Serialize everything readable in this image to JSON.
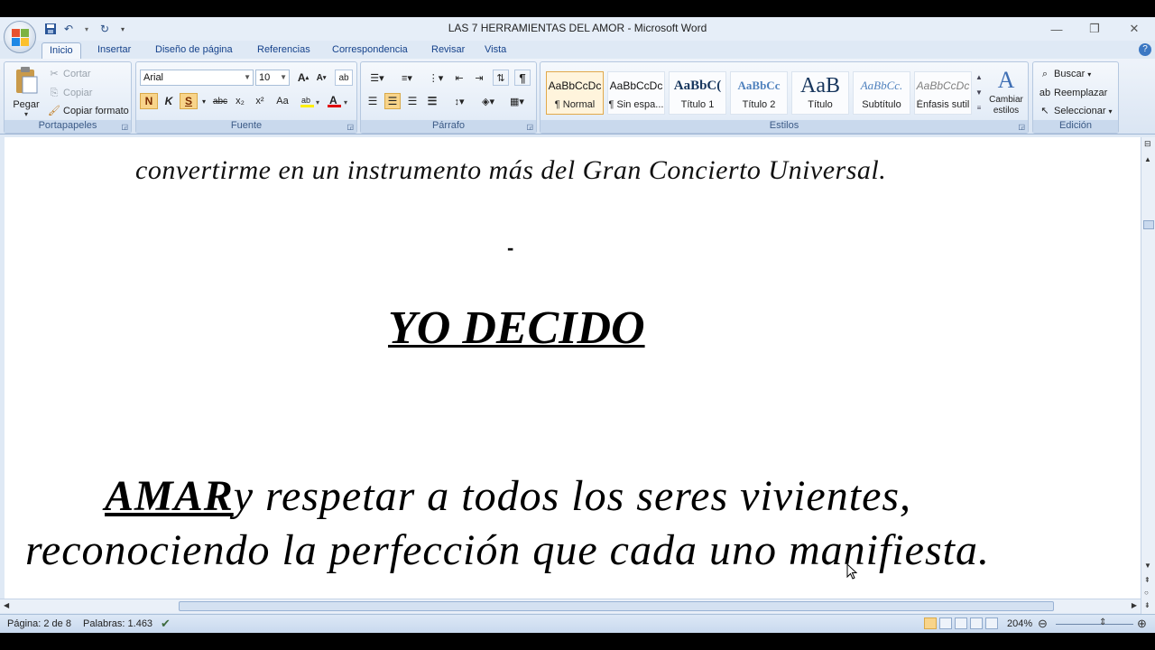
{
  "window": {
    "title": "LAS 7 HERRAMIENTAS DEL AMOR - Microsoft Word"
  },
  "tabs": [
    "Inicio",
    "Insertar",
    "Diseño de página",
    "Referencias",
    "Correspondencia",
    "Revisar",
    "Vista"
  ],
  "ribbon": {
    "portapapeles": {
      "label": "Portapapeles",
      "pegar": "Pegar",
      "cortar": "Cortar",
      "copiar": "Copiar",
      "copiar_formato": "Copiar formato"
    },
    "fuente": {
      "label": "Fuente",
      "font_name": "Arial",
      "font_size": "10",
      "bold": "N",
      "italic": "K",
      "underline": "S",
      "strike": "abc",
      "subscript": "x₂",
      "superscript": "x²",
      "case": "Aa"
    },
    "parrafo": {
      "label": "Párrafo"
    },
    "estilos": {
      "label": "Estilos",
      "items": [
        {
          "sample": "AaBbCcDc",
          "name": "¶ Normal"
        },
        {
          "sample": "AaBbCcDc",
          "name": "¶ Sin espa..."
        },
        {
          "sample": "AaBbC(",
          "name": "Título 1"
        },
        {
          "sample": "AaBbCc",
          "name": "Título 2"
        },
        {
          "sample": "AaB",
          "name": "Título"
        },
        {
          "sample": "AaBbCc.",
          "name": "Subtítulo"
        },
        {
          "sample": "AaBbCcDc",
          "name": "Énfasis sutil"
        }
      ],
      "cambiar_estilos": "Cambiar estilos"
    },
    "edicion": {
      "label": "Edición",
      "buscar": "Buscar",
      "reemplazar": "Reemplazar",
      "seleccionar": "Seleccionar"
    }
  },
  "document": {
    "line1": "convertirme en un instrumento más del Gran Concierto Universal.",
    "dash": "-",
    "heading": "YO DECIDO",
    "para_bold": "AMAR",
    "para_rest1": "y respetar a todos los seres vivientes,",
    "para_line2": "reconociendo la perfección que cada uno manifiesta."
  },
  "status": {
    "page": "Página: 2 de 8",
    "words": "Palabras: 1.463",
    "zoom": "204%"
  },
  "colors": {
    "ribbon_bg": "#dae5f3",
    "tab_text": "#15428b",
    "selected_style": "#fff4dc",
    "highlight_button": "#f8d48a"
  }
}
